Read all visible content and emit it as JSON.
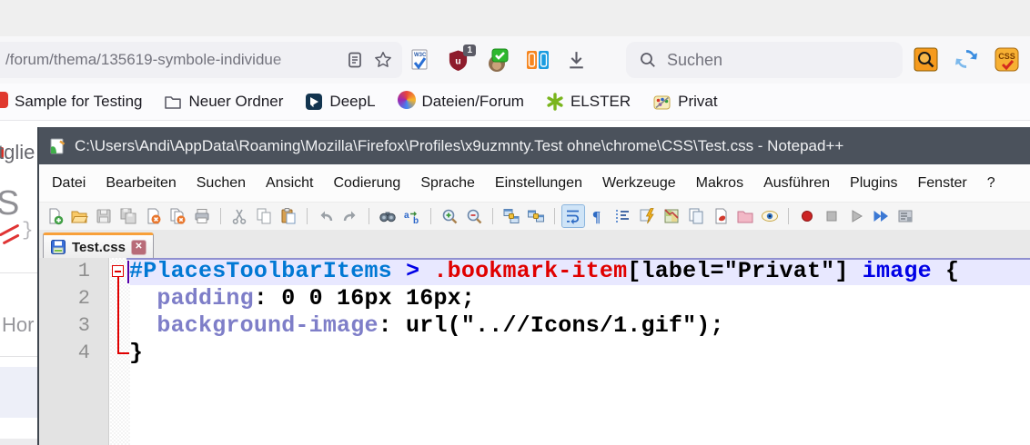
{
  "browser": {
    "url_text": "/forum/thema/135619-symbole-individue",
    "search_placeholder": "Suchen",
    "shield_badge": "1",
    "accent_colors": {
      "address_bg": "#f0f0f4",
      "bookmark_text": "#1c1b22"
    },
    "bookmarks": [
      {
        "label": "Sample for Testing",
        "icon": "red-sliver"
      },
      {
        "label": "Neuer Ordner",
        "icon": "folder-outline"
      },
      {
        "label": "DeepL",
        "icon": "deepl"
      },
      {
        "label": "Dateien/Forum",
        "icon": "forum-circle"
      },
      {
        "label": "ELSTER",
        "icon": "elster-asterisk"
      },
      {
        "label": "Privat",
        "icon": "palette"
      }
    ]
  },
  "page_fragments": {
    "f1": "tglie",
    "f2": "S",
    "f3": "}",
    "f4": "Hor"
  },
  "notepad": {
    "title": "C:\\Users\\Andi\\AppData\\Roaming\\Mozilla\\Firefox\\Profiles\\x9uzmnty.Test ohne\\chrome\\CSS\\Test.css - Notepad++",
    "menu": [
      "Datei",
      "Bearbeiten",
      "Suchen",
      "Ansicht",
      "Codierung",
      "Sprache",
      "Einstellungen",
      "Werkzeuge",
      "Makros",
      "Ausführen",
      "Plugins",
      "Fenster",
      "?"
    ],
    "toolbar": [
      "new-file",
      "open-folder",
      "save",
      "save-all",
      "close",
      "close-all",
      "print",
      "|",
      "cut",
      "copy",
      "paste",
      "|",
      "undo",
      "redo",
      "|",
      "find",
      "replace",
      "|",
      "zoom-in",
      "zoom-out",
      "|",
      "sync-vertical",
      "sync-horizontal",
      "|",
      "word-wrap",
      "show-all-chars",
      "indent-guide",
      "function-completion",
      "document-map",
      "doc-switcher",
      "run-external",
      "project-folder",
      "file-monitoring",
      "|",
      "record-macro",
      "stop-macro",
      "play-macro",
      "run-macro-multi",
      "save-macro"
    ],
    "toolbar_active": "word-wrap",
    "tab_label": "Test.css",
    "token_colors": {
      "id": "#0078d4",
      "tag": "#0000e6",
      "cls": "#e00000",
      "prop": "#7e7ec8",
      "def": "#000000"
    },
    "editor_colors": {
      "caret_line": "#e8e8ff",
      "fold_marker": "#e00000",
      "line_number": "#8f8f8f"
    },
    "code_lines": [
      {
        "num": "1",
        "tokens": [
          [
            "id",
            "#PlacesToolbarItems"
          ],
          [
            "def",
            " "
          ],
          [
            "tag",
            ">"
          ],
          [
            "def",
            " "
          ],
          [
            "cls",
            ".bookmark-item"
          ],
          [
            "def",
            "[label=\"Privat\"] "
          ],
          [
            "tag",
            "image"
          ],
          [
            "def",
            " {"
          ]
        ]
      },
      {
        "num": "2",
        "tokens": [
          [
            "def",
            "  "
          ],
          [
            "prop",
            "padding"
          ],
          [
            "def",
            ": 0 0 16px 16px;"
          ]
        ]
      },
      {
        "num": "3",
        "tokens": [
          [
            "def",
            "  "
          ],
          [
            "prop",
            "background-image"
          ],
          [
            "def",
            ": url(\"..//Icons/1.gif\");"
          ]
        ]
      },
      {
        "num": "4",
        "tokens": [
          [
            "def",
            "}"
          ]
        ]
      }
    ]
  }
}
